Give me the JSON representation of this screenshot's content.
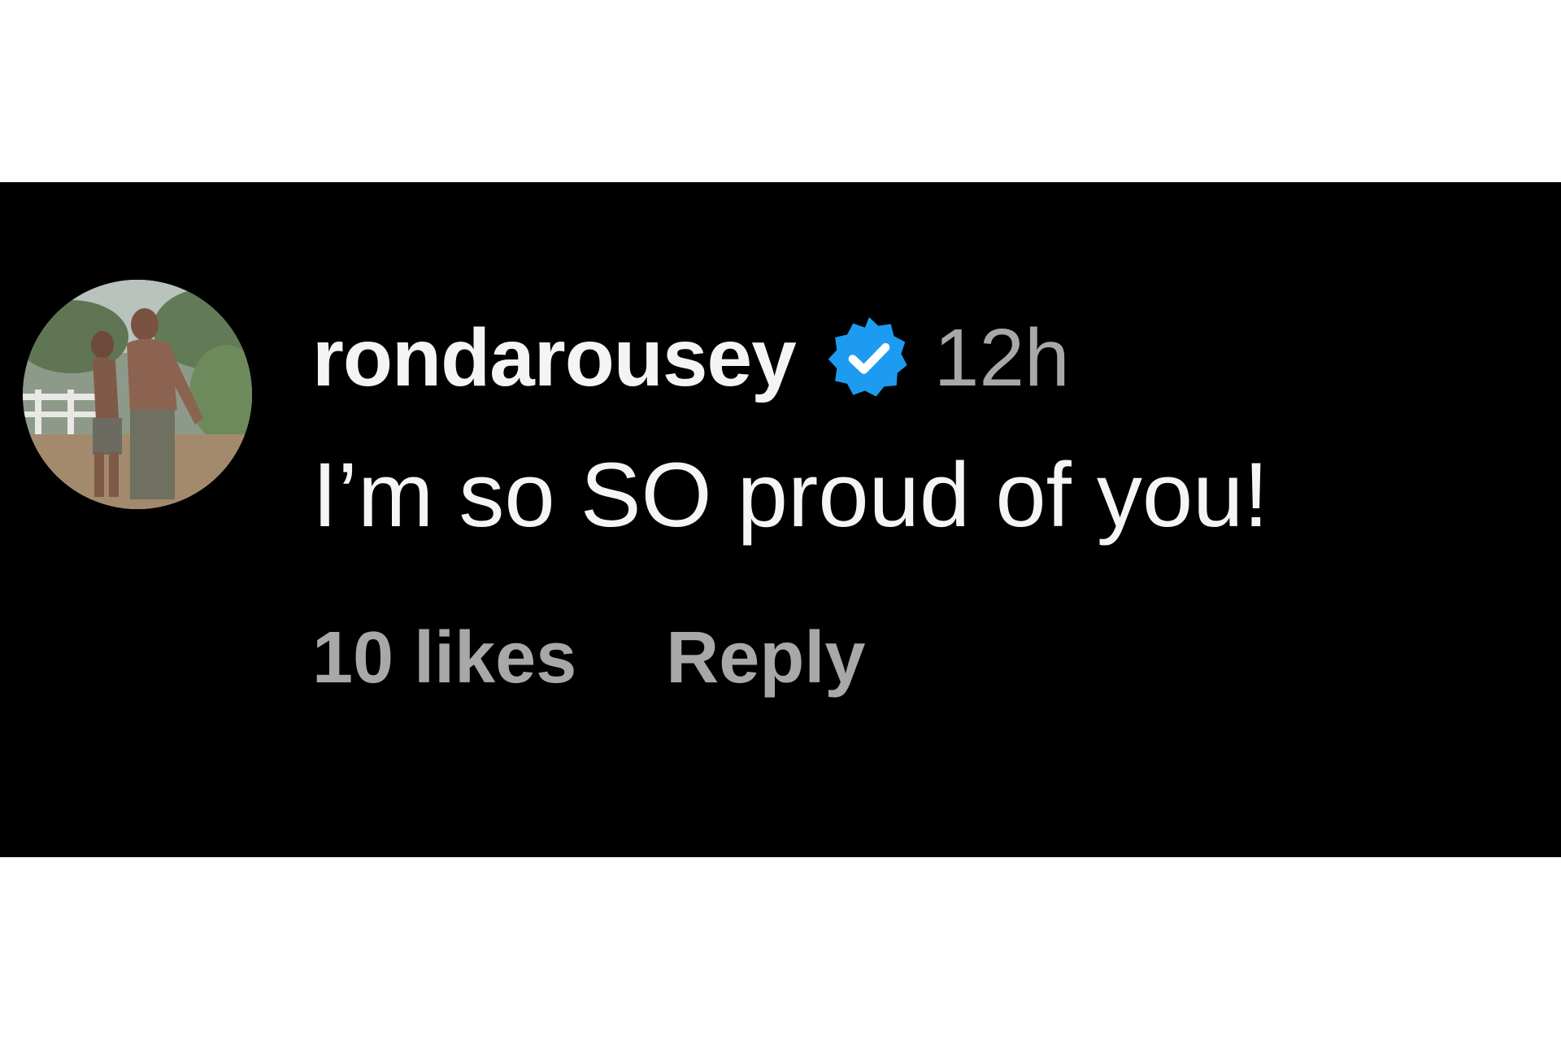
{
  "comment": {
    "username": "rondarousey",
    "verified_icon": "verified-badge-icon",
    "timestamp": "12h",
    "text": "I’m so SO proud of you!",
    "likes_label": "10 likes",
    "reply_label": "Reply"
  },
  "colors": {
    "panel_background": "#000000",
    "username": "#f4f4f4",
    "secondary_text": "#a8a8a8",
    "verified_badge": "#1d9bf0"
  }
}
